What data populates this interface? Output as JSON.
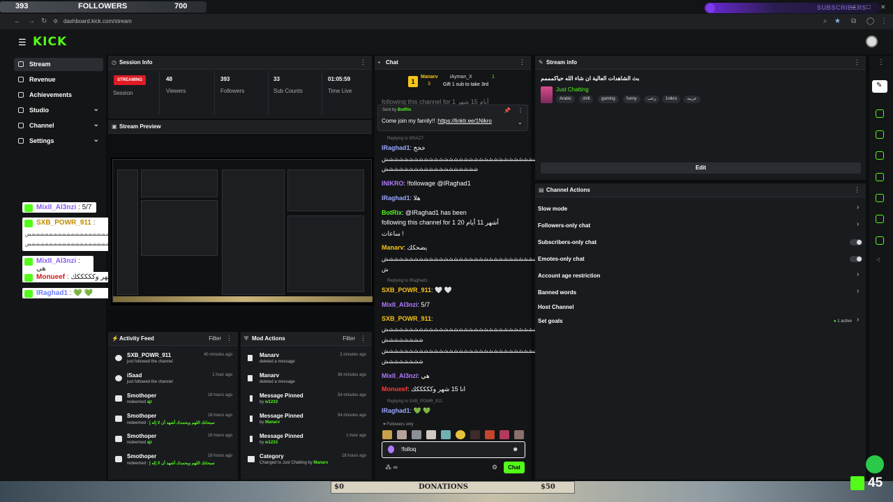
{
  "overlay": {
    "followers_count_left": "393",
    "followers_label": "FOLLOWERS",
    "followers_goal": "700",
    "subscribers_label": "SUBSCRIBERS",
    "subscribers_progress": 0.04
  },
  "browser": {
    "url": "dashboard.kick.com/stream"
  },
  "app": {
    "logo": "KICK",
    "menu_icon": "hamburger-icon"
  },
  "sidebar": {
    "items": [
      {
        "label": "Stream",
        "icon": "stream-icon",
        "active": true
      },
      {
        "label": "Revenue",
        "icon": "revenue-icon"
      },
      {
        "label": "Achievements",
        "icon": "trophy-icon"
      },
      {
        "label": "Studio",
        "icon": "studio-icon",
        "expandable": true
      },
      {
        "label": "Channel",
        "icon": "channel-icon",
        "expandable": true
      },
      {
        "label": "Settings",
        "icon": "gear-icon",
        "expandable": true
      }
    ]
  },
  "stream_overlay_chat": [
    {
      "user": "MixII_Al3nzi",
      "text": ": 5/7"
    },
    {
      "user": "SXB_POWR_911",
      "text": ":"
    },
    {
      "user": "MixII_Al3nzi",
      "text": ": هي"
    },
    {
      "user": "Monueef",
      "text": ": انا 15 شهر وكككككك"
    },
    {
      "user": "IRaghad1",
      "text": ": 💚 💚"
    }
  ],
  "session_info": {
    "title": "Session Info",
    "status": "STREAMING",
    "status_label": "Session",
    "stats": [
      {
        "value": "48",
        "label": "Viewers"
      },
      {
        "value": "393",
        "label": "Followers"
      },
      {
        "value": "33",
        "label": "Sub Counts"
      },
      {
        "value": "01:05:59",
        "label": "Time Live"
      }
    ]
  },
  "stream_preview": {
    "title": "Stream Preview"
  },
  "activity_feed": {
    "title": "Activity Feed",
    "filter": "Filter",
    "items": [
      {
        "name": "SXB_POWR_911",
        "desc": "just followed the channel",
        "highlight": "",
        "time": "40 minutes ago",
        "icon": "heart-icon"
      },
      {
        "name": "iSaad",
        "desc": "just followed the channel",
        "highlight": "",
        "time": "1 hour ago",
        "icon": "heart-icon"
      },
      {
        "name": "Smothoper",
        "desc": "redeemed",
        "highlight": "ajr",
        "time": "18 hours ago",
        "icon": "reward-icon"
      },
      {
        "name": "Smothoper",
        "desc": "redeemed :",
        "highlight": "سبحانك اللهم وبحمدك أشهد أن لا إله إ",
        "time": "18 hours ago",
        "icon": "reward-icon"
      },
      {
        "name": "Smothoper",
        "desc": "redeemed",
        "highlight": "ajr",
        "time": "18 hours ago",
        "icon": "reward-icon"
      },
      {
        "name": "Smothoper",
        "desc": "redeemed :",
        "highlight": "سبحانك اللهم وبحمدك أشهد أن لا إله إ",
        "time": "18 hours ago",
        "icon": "reward-icon"
      }
    ]
  },
  "mod_actions": {
    "title": "Mod Actions",
    "filter": "Filter",
    "items": [
      {
        "name": "Manarv",
        "desc": "deleted a message",
        "by": "",
        "time": "2 minutes ago",
        "icon": "trash-icon"
      },
      {
        "name": "Manarv",
        "desc": "deleted a message",
        "by": "",
        "time": "36 minutes ago",
        "icon": "trash-icon"
      },
      {
        "name": "Message Pinned",
        "desc": "by",
        "by": "w1233",
        "time": "54 minutes ago",
        "icon": "pin-icon"
      },
      {
        "name": "Message Pinned",
        "desc": "by",
        "by": "Manarv",
        "time": "54 minutes ago",
        "icon": "pin-icon"
      },
      {
        "name": "Message Pinned",
        "desc": "by",
        "by": "w1233",
        "time": "1 hour ago",
        "icon": "pin-icon"
      },
      {
        "name": "Category",
        "desc": "Changed to Just Chatting by",
        "by": "Manarv",
        "time": "18 hours ago",
        "icon": "category-icon"
      }
    ]
  },
  "chat": {
    "title": "Chat",
    "gift_banner": {
      "user": "Manarv",
      "count": "3",
      "user2": "iAyman_X",
      "count2": "1",
      "text": "Gift 1 sub to take 3rd"
    },
    "pinned": {
      "sent_by": "Sent by",
      "user": "BotRix",
      "message": "Come join my family!! :",
      "link": "https://linktr.ee/1Nikro"
    },
    "faded_line": "following this channel for 1 أيام 15 شهر",
    "messages": [
      {
        "reply": "Replying to MSAZ7:",
        "user": "IRaghad1",
        "color": "blue",
        "text": ": خخخ"
      },
      {
        "hash": "ششششششششششششششششششششششششششششششش"
      },
      {
        "hash": "ششششششششششششششششششش"
      },
      {
        "user": "INIKRO",
        "color": "purple",
        "text": ": !followage @IRaghad1"
      },
      {
        "user": "IRaghad1",
        "color": "blue",
        "text": ": هلا"
      },
      {
        "user": "BotRix",
        "color": "green",
        "text": ": @IRaghad1 has been"
      },
      {
        "text2": "following this channel for 1 20 أشهر 11 أيام"
      },
      {
        "text2": "ساعات !"
      },
      {
        "user": "Manarv",
        "color": "yellow",
        "text": ": يضحكك"
      },
      {
        "hash": "ششششششششششششششششششششششششششششششش"
      },
      {
        "hash": "ش"
      },
      {
        "reply": "Replying to IRaghad1:"
      },
      {
        "user": "SXB_POWR_911",
        "color": "yellow",
        "text": ": 🤍 🤍"
      },
      {
        "user": "MixII_Al3nzi",
        "color": "purple",
        "text": ": 5/7"
      },
      {
        "user": "SXB_POWR_911",
        "color": "yellow",
        "text": ":"
      },
      {
        "hash": "ششششششششششششششششششششششششششششششش"
      },
      {
        "hash": "شششششششش"
      },
      {
        "hash": "ششششششششششششششششششششششششششششششش"
      },
      {
        "hash": "شششششششش"
      },
      {
        "user": "MixII_Al3nzi",
        "color": "purple",
        "text": ": هي"
      },
      {
        "user": "Monueef",
        "color": "red",
        "text": ": انا 15 شهر وكككككك"
      },
      {
        "reply": "Replying to SXB_POWR_911:"
      },
      {
        "user": "IRaghad1",
        "color": "blue",
        "text": ": 💚 💚"
      }
    ],
    "followers_only": "Followers only",
    "input_value": "!folloq",
    "send_label": "Chat"
  },
  "stream_info": {
    "title": "Stream info",
    "stream_title": "بث الشاهدات العالية ان شاء الله حياكمممم",
    "category": "Just Chatting",
    "tags": [
      "Arabic",
      "chill",
      "gaming",
      "funny",
      "رعب",
      "1nikro",
      "عربيه"
    ],
    "edit_label": "Edit"
  },
  "channel_actions": {
    "title": "Channel Actions",
    "items": [
      {
        "label": "Slow mode",
        "control": "chevron"
      },
      {
        "label": "Followers-only chat",
        "control": "chevron"
      },
      {
        "label": "Subscribers-only chat",
        "control": "toggle"
      },
      {
        "label": "Emotes-only chat",
        "control": "toggle"
      },
      {
        "label": "Account age restriction",
        "control": "chevron"
      },
      {
        "label": "Banned words",
        "control": "chevron"
      },
      {
        "label": "Host Channel",
        "control": "none"
      },
      {
        "label": "Set goals",
        "control": "chevron",
        "status": "1 active"
      }
    ]
  },
  "bottom": {
    "donations_label": "DONATIONS",
    "donations_left": "$0",
    "donations_right": "$50",
    "kick_count": "45"
  },
  "colors": {
    "brand": "#53fc18",
    "live": "#e01b24",
    "panel": "#191b1f"
  }
}
